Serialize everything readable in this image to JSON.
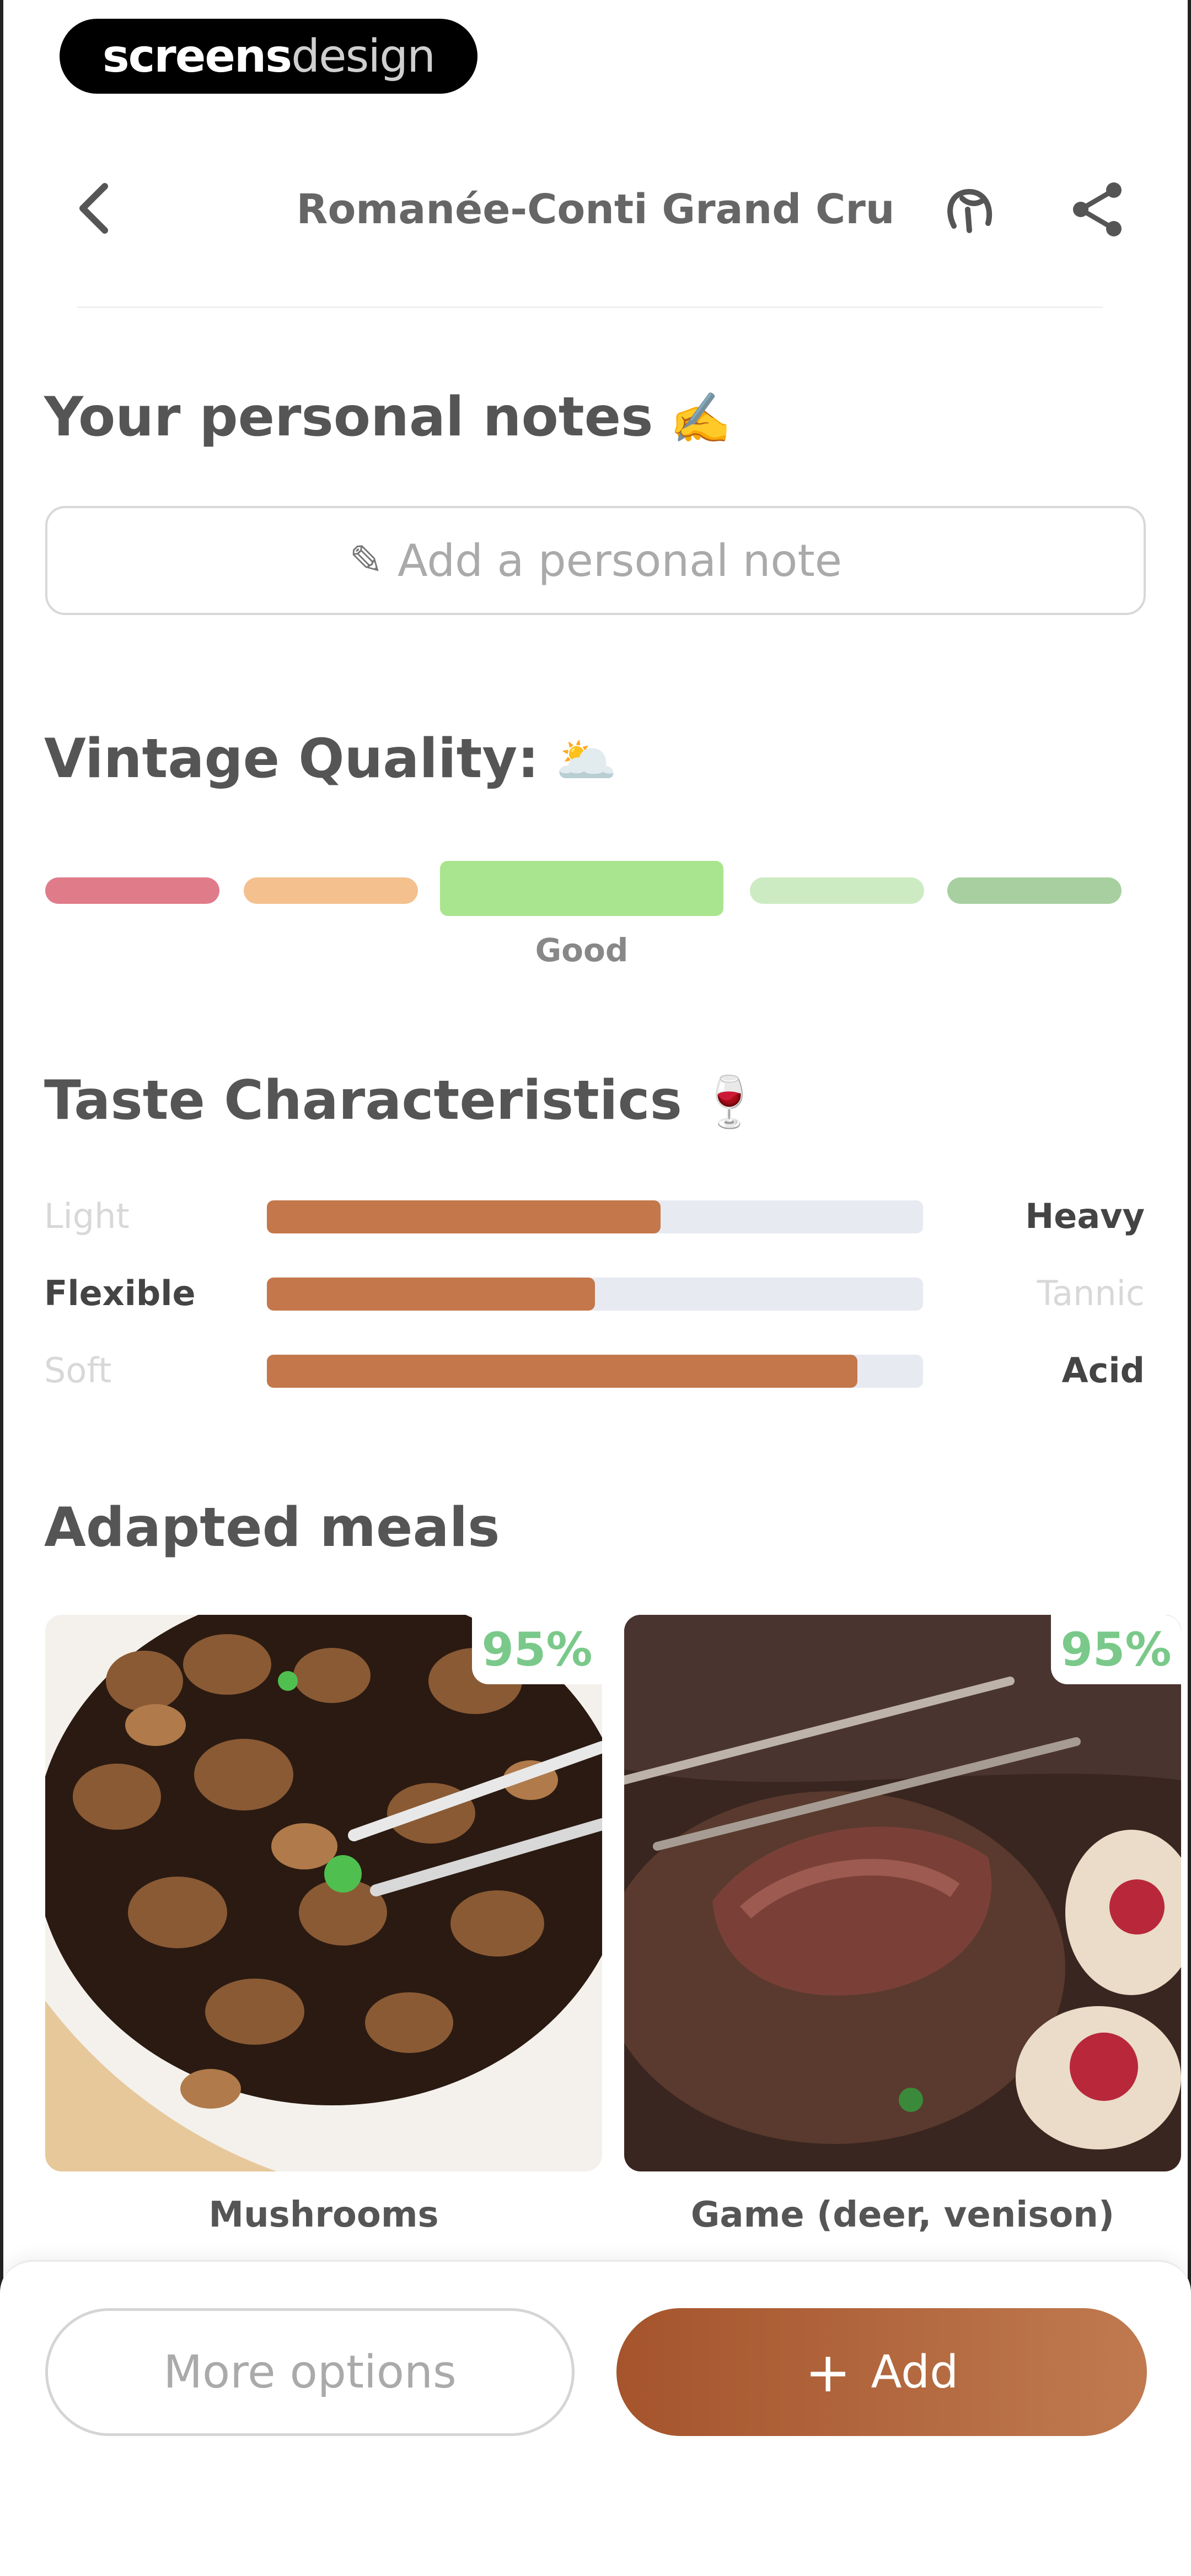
{
  "watermark": {
    "bold": "screens",
    "light": "design"
  },
  "header": {
    "title": "Romanée-Conti Grand Cru",
    "back_icon": "chevron-left-icon",
    "fridge_icon": "decanter-icon",
    "share_icon": "share-icon"
  },
  "personal_notes": {
    "heading": "Your personal notes",
    "heading_emoji": "✍️",
    "button_label": "Add a personal note",
    "button_icon": "pencil-icon"
  },
  "vintage": {
    "heading": "Vintage Quality:",
    "heading_emoji": "🌥️",
    "levels": [
      {
        "color": "#e07c8a"
      },
      {
        "color": "#f3c08e"
      },
      {
        "color": "#a9e58e",
        "selected": true
      },
      {
        "color": "#cdebc3"
      },
      {
        "color": "#a8cfa0"
      }
    ],
    "selected_label": "Good"
  },
  "taste": {
    "heading": "Taste Characteristics",
    "heading_emoji": "🍷",
    "rows": [
      {
        "left": "Light",
        "right": "Heavy",
        "value": 0.6
      },
      {
        "left": "Flexible",
        "right": "Tannic",
        "value": 0.5
      },
      {
        "left": "Soft",
        "right": "Acid",
        "value": 0.9
      }
    ]
  },
  "meals": {
    "heading": "Adapted meals",
    "items": [
      {
        "name": "Mushrooms",
        "match": "95%"
      },
      {
        "name": "Game (deer, venison)",
        "match": "95%"
      }
    ]
  },
  "actions": {
    "more": "More options",
    "add": "Add",
    "add_icon": "plus-icon"
  },
  "colors": {
    "accent": "#c4774a",
    "match_green": "#7ac98a",
    "track": "#e8eaf2"
  }
}
